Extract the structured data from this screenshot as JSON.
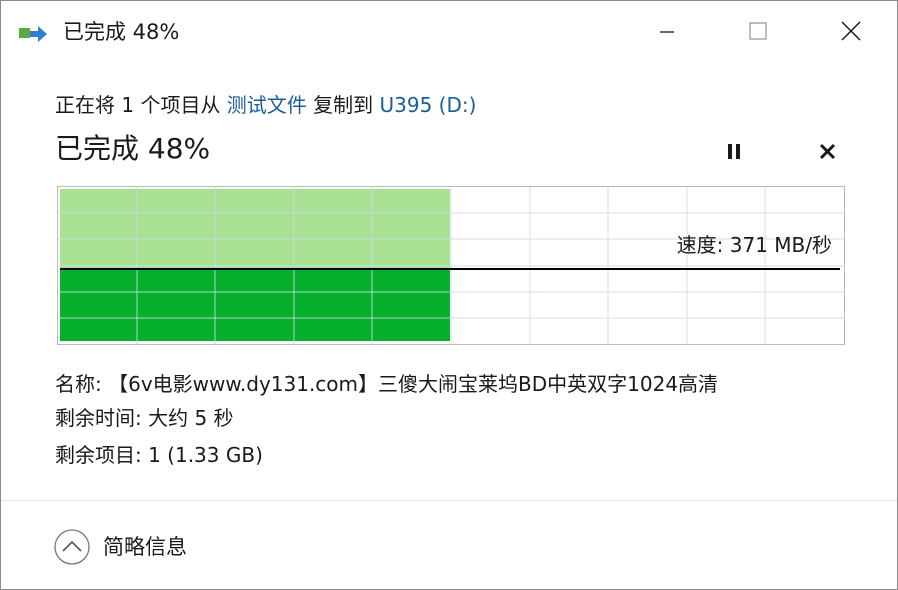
{
  "window": {
    "title": "已完成 48%",
    "icons": {
      "app": "copy-arrow-icon",
      "minimize": "minimize-icon",
      "maximize": "maximize-icon",
      "close": "close-icon"
    }
  },
  "operation": {
    "prefix": "正在将 1 个项目从 ",
    "source": "测试文件",
    "middle": " 复制到 ",
    "destination": "U395 (D:)"
  },
  "progress": {
    "title": "已完成 48%",
    "fraction": 0.48,
    "pause_icon": "pause-icon",
    "cancel_icon": "cancel-x-icon"
  },
  "graph": {
    "speed_label": "速度: 371 MB/秒",
    "colors": {
      "area": "#a8e094",
      "bar": "#06b02a",
      "grid": "#c9dde8",
      "line": "#000000",
      "border": "#b8b8b8"
    }
  },
  "details": {
    "name_line": "名称:  【6v电影www.dy131.com】三傻大闹宝莱坞BD中英双字1024高清",
    "time_line": "剩余时间: 大约 5 秒",
    "items_line": "剩余项目: 1 (1.33 GB)"
  },
  "footer": {
    "toggle_label": "简略信息",
    "toggle_icon": "chevron-up-circle-icon"
  }
}
